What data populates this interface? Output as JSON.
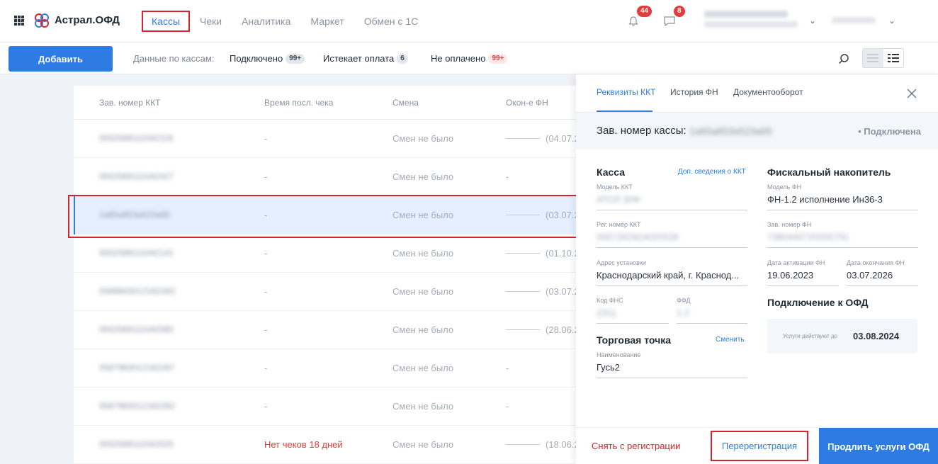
{
  "app": {
    "logo_text": "Астрал.ОФД"
  },
  "nav": {
    "items": [
      "Кассы",
      "Чеки",
      "Аналитика",
      "Маркет",
      "Обмен с 1С"
    ]
  },
  "header": {
    "notifications_count": "44",
    "messages_count": "8"
  },
  "toolbar": {
    "add_label": "Добавить",
    "stats_label": "Данные по кассам:",
    "connected_label": "Подключено",
    "connected_count": "99+",
    "expiring_label": "Истекает оплата",
    "expiring_count": "6",
    "unpaid_label": "Не оплачено",
    "unpaid_count": "99+"
  },
  "table": {
    "columns": [
      "Зав. номер ККТ",
      "Время посл. чека",
      "Смена",
      "Окон-е ФН"
    ],
    "rows": [
      {
        "serial": "0002589111042119",
        "time": "-",
        "shift": "Смен не было",
        "fn": "(04.07.2",
        "fn_line": true
      },
      {
        "serial": "0002589111042427",
        "time": "-",
        "shift": "Смен не было",
        "fn": "-",
        "fn_line": false
      },
      {
        "serial": "1a65a853a523a65",
        "time": "-",
        "shift": "Смен не было",
        "fn": "(03.07.2",
        "fn_line": true
      },
      {
        "serial": "0002589111042141",
        "time": "-",
        "shift": "Смен не было",
        "fn": "(01.10.2",
        "fn_line": true
      },
      {
        "serial": "0589843012182283",
        "time": "-",
        "shift": "Смен не было",
        "fn": "(03.07.2",
        "fn_line": true
      },
      {
        "serial": "0002589111042080",
        "time": "-",
        "shift": "Смен не было",
        "fn": "(28.06.2",
        "fn_line": true
      },
      {
        "serial": "0587983012182287",
        "time": "-",
        "shift": "Смен не было",
        "fn": "-",
        "fn_line": false
      },
      {
        "serial": "0587983012182282",
        "time": "-",
        "shift": "Смен не было",
        "fn": "-",
        "fn_line": false
      },
      {
        "serial": "0002589111042025",
        "time": "Нет чеков 18 дней",
        "shift": "Смен не было",
        "fn": "(18.06.2",
        "fn_line": true
      }
    ]
  },
  "panel": {
    "tabs": [
      "Реквизиты ККТ",
      "История ФН",
      "Документооборот"
    ],
    "title": "Зав. номер кассы:",
    "serial": "1a65a853a523a65",
    "status": "• Подключена",
    "kassa": {
      "title": "Касса",
      "more_link": "Доп. сведения о ККТ",
      "model_label": "Модель ККТ",
      "model_value": "АТОЛ 30Ф",
      "reg_label": "Рег. номер ККТ",
      "reg_value": "0007262924020528",
      "address_label": "Адрес установки",
      "address_value": "Краснодарский край, г. Краснод...",
      "fns_label": "Код ФНС",
      "fns_value": "2311",
      "ffd_label": "ФФД",
      "ffd_value": "1.2"
    },
    "fn": {
      "title": "Фискальный накопитель",
      "model_label": "Модель ФН",
      "model_value": "ФН-1.2 исполнение Ин36-3",
      "serial_label": "Зав. номер ФН",
      "serial_value": "7380440720355791",
      "activation_label": "Дата активации ФН",
      "activation_value": "19.06.2023",
      "expiry_label": "Дата окончания ФН",
      "expiry_value": "03.07.2026"
    },
    "ofd": {
      "title": "Подключение к ОФД",
      "services_label": "Услуги действуют до",
      "services_value": "03.08.2024"
    },
    "shop": {
      "title": "Торговая точка",
      "change_link": "Сменить",
      "name_label": "Наименование",
      "name_value": "Гусь2"
    },
    "footer": {
      "unregister_label": "Снять с регистрации",
      "reregister_label": "Перерегистрация",
      "extend_label": "Продлить услуги ОФД"
    }
  }
}
